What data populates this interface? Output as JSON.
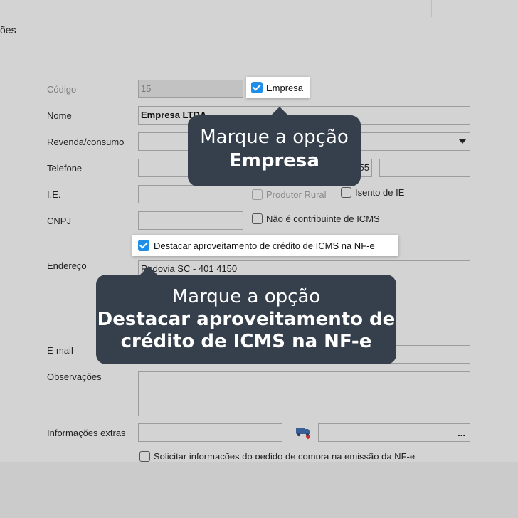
{
  "tab_fragment": "ões",
  "form": {
    "codigo": {
      "label": "Código",
      "value": "15"
    },
    "empresa_checkbox": {
      "label": "Empresa",
      "checked": true
    },
    "nome": {
      "label": "Nome",
      "value": "Empresa LTDA"
    },
    "revenda": {
      "label": "Revenda/consumo",
      "value": ""
    },
    "telefone": {
      "label": "Telefone",
      "value": "",
      "partial": "55"
    },
    "ie": {
      "label": "I.E."
    },
    "produtor_rural": {
      "label": "Produtor Rural",
      "checked": false
    },
    "isento_ie": {
      "label": "Isento de IE",
      "checked": false
    },
    "cnpj": {
      "label": "CNPJ"
    },
    "nao_contribuinte": {
      "label": "Não é contribuinte de ICMS",
      "checked": false
    },
    "destacar": {
      "label": "Destacar aproveitamento de crédito de ICMS na NF-e",
      "checked": true
    },
    "endereco": {
      "label": "Endereço",
      "value": "Rodovia SC - 401 4150"
    },
    "email": {
      "label": "E-mail"
    },
    "observacoes": {
      "label": "Observações"
    },
    "info_extras": {
      "label": "Informações extras",
      "lookup_button": "..."
    },
    "bottom_partial": "Solicitar informações do pedido de compra na emissão da NF-e"
  },
  "callouts": [
    {
      "line1": "Marque a opção",
      "line2": "Empresa"
    },
    {
      "line1": "Marque a opção",
      "line2": "Destacar aproveitamento de",
      "line3": "crédito de ICMS na NF-e"
    }
  ],
  "colors": {
    "accent": "#1f8ee8",
    "callout_bg": "#363f4c",
    "background": "#d3d3d3"
  }
}
